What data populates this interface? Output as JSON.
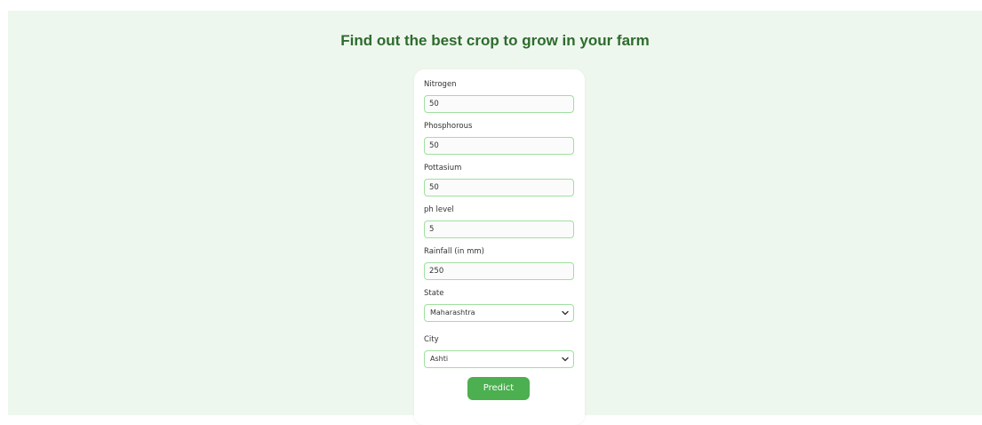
{
  "page": {
    "title": "Find out the best crop to grow in your farm"
  },
  "form": {
    "nitrogen": {
      "label": "Nitrogen",
      "value": "50"
    },
    "phosphorous": {
      "label": "Phosphorous",
      "value": "50"
    },
    "pottasium": {
      "label": "Pottasium",
      "value": "50"
    },
    "ph": {
      "label": "ph level",
      "value": "5"
    },
    "rainfall": {
      "label": "Rainfall (in mm)",
      "value": "250"
    },
    "state": {
      "label": "State",
      "selected": "Maharashtra"
    },
    "city": {
      "label": "City",
      "selected": "Ashti"
    },
    "submit_label": "Predict"
  },
  "colors": {
    "page_background": "#eef7ee",
    "title_color": "#2e6b2e",
    "input_border": "#9fe09f",
    "button_background": "#4caf50",
    "button_text": "#ffffff"
  },
  "icons": {
    "select_arrow": "chevron-down-icon"
  }
}
